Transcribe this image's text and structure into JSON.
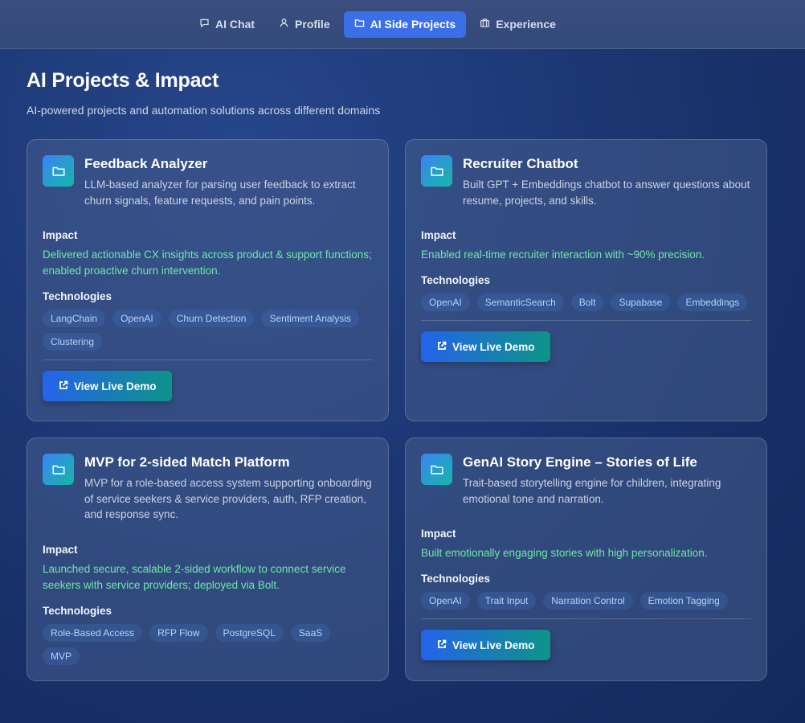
{
  "nav": {
    "items": [
      {
        "label": "AI Chat",
        "icon": "chat-icon",
        "active": false
      },
      {
        "label": "Profile",
        "icon": "user-icon",
        "active": false
      },
      {
        "label": "AI Side Projects",
        "icon": "folder-icon",
        "active": true
      },
      {
        "label": "Experience",
        "icon": "briefcase-icon",
        "active": false
      }
    ]
  },
  "page": {
    "title": "AI Projects & Impact",
    "subtitle": "AI-powered projects and automation solutions across different domains"
  },
  "labels": {
    "impact": "Impact",
    "technologies": "Technologies",
    "demo": "View Live Demo"
  },
  "projects": [
    {
      "title": "Feedback Analyzer",
      "description": "LLM-based analyzer for parsing user feedback to extract churn signals, feature requests, and pain points.",
      "impact": "Delivered actionable CX insights across product & support functions; enabled proactive churn intervention.",
      "tags": [
        "LangChain",
        "OpenAI",
        "Churn Detection",
        "Sentiment Analysis",
        "Clustering"
      ],
      "has_demo": true
    },
    {
      "title": "Recruiter Chatbot",
      "description": "Built GPT + Embeddings chatbot to answer questions about resume, projects, and skills.",
      "impact": "Enabled real-time recruiter interaction with ~90% precision.",
      "tags": [
        "OpenAI",
        "SemanticSearch",
        "Bolt",
        "Supabase",
        "Embeddings"
      ],
      "has_demo": true
    },
    {
      "title": "MVP for 2-sided Match Platform",
      "description": "MVP for a role-based access system supporting onboarding of service seekers & service providers, auth, RFP creation, and response sync.",
      "impact": "Launched secure, scalable 2-sided workflow to connect service seekers with service providers; deployed via Bolt.",
      "tags": [
        "Role-Based Access",
        "RFP Flow",
        "PostgreSQL",
        "SaaS",
        "MVP"
      ],
      "has_demo": false
    },
    {
      "title": "GenAI Story Engine – Stories of Life",
      "description": "Trait-based storytelling engine for children, integrating emotional tone and narration.",
      "impact": "Built emotionally engaging stories with high personalization.",
      "tags": [
        "OpenAI",
        "Trait Input",
        "Narration Control",
        "Emotion Tagging"
      ],
      "has_demo": true
    }
  ],
  "colors": {
    "accent": "#3b6fe8",
    "impact_green": "#6ee7a8",
    "gradient_start": "#2563eb",
    "gradient_end": "#0d9488"
  }
}
